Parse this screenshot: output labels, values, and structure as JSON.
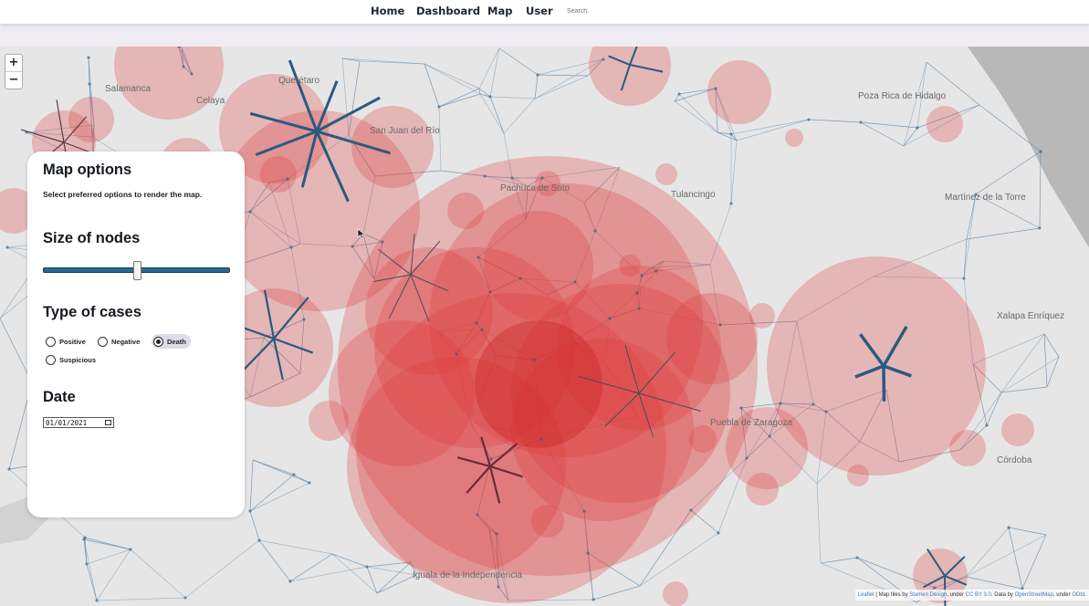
{
  "nav": {
    "links": [
      "Home",
      "Dashboard",
      "Map",
      "User"
    ],
    "search_placeholder": "Search."
  },
  "panel": {
    "title": "Map options",
    "description": "Select preferred options to render the map.",
    "size_heading": "Size of nodes",
    "node_size_fraction": 0.5,
    "type_heading": "Type of cases",
    "case_types": [
      "Positive",
      "Negative",
      "Death",
      "Suspicious"
    ],
    "selected_case_type": "Death",
    "date_heading": "Date",
    "date_value": "01/01/2021"
  },
  "map": {
    "zoom_in": "+",
    "zoom_out": "−",
    "attribution": {
      "leaflet": "Leaflet",
      "tiles_prefix": " | Map tiles by ",
      "stamen": "Stamen Design",
      "under1": ", under ",
      "ccby": "CC BY 3.0",
      "data_prefix": ". Data by ",
      "osm": "OpenStreetMap",
      "under2": ", under ",
      "odbl": "ODbL"
    },
    "place_labels": [
      "Salamanca",
      "Celaya",
      "Querétaro",
      "San Juan del Río",
      "Pachuca de Soto",
      "Tulancingo",
      "Poza Rica de Hidalgo",
      "Martínez de la Torre",
      "Xalapa Enríquez",
      "Puebla de Zaragoza",
      "Córdoba",
      "Iguala de la Independencia"
    ],
    "colors": {
      "circle_fill": "#e03a3a",
      "edge_light": "#6a8fb0",
      "edge_dark": "#2a5a80",
      "land": "#e6e6e6",
      "sea": "#b8b8b8"
    }
  }
}
